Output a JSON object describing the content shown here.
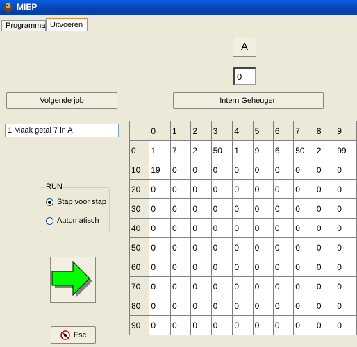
{
  "window": {
    "title": "MIEP"
  },
  "tabs": [
    {
      "label": "Programma"
    },
    {
      "label": "Uitvoeren"
    }
  ],
  "register_label": "A",
  "accumulator_value": "0",
  "buttons": {
    "next_job": "Volgende job",
    "internal_memory": "Intern Geheugen",
    "esc": "Esc"
  },
  "current_job": "1 Maak getal 7 in A",
  "run": {
    "legend": "RUN",
    "options": [
      {
        "label": "Stap voor stap",
        "selected": true
      },
      {
        "label": "Automatisch",
        "selected": false
      }
    ]
  },
  "memory": {
    "columns": [
      "0",
      "1",
      "2",
      "3",
      "4",
      "5",
      "6",
      "7",
      "8",
      "9"
    ],
    "rows": [
      {
        "label": "0",
        "cells": [
          "1",
          "7",
          "2",
          "50",
          "1",
          "9",
          "6",
          "50",
          "2",
          "99"
        ]
      },
      {
        "label": "10",
        "cells": [
          "19",
          "0",
          "0",
          "0",
          "0",
          "0",
          "0",
          "0",
          "0",
          "0"
        ]
      },
      {
        "label": "20",
        "cells": [
          "0",
          "0",
          "0",
          "0",
          "0",
          "0",
          "0",
          "0",
          "0",
          "0"
        ]
      },
      {
        "label": "30",
        "cells": [
          "0",
          "0",
          "0",
          "0",
          "0",
          "0",
          "0",
          "0",
          "0",
          "0"
        ]
      },
      {
        "label": "40",
        "cells": [
          "0",
          "0",
          "0",
          "0",
          "0",
          "0",
          "0",
          "0",
          "0",
          "0"
        ]
      },
      {
        "label": "50",
        "cells": [
          "0",
          "0",
          "0",
          "0",
          "0",
          "0",
          "0",
          "0",
          "0",
          "0"
        ]
      },
      {
        "label": "60",
        "cells": [
          "0",
          "0",
          "0",
          "0",
          "0",
          "0",
          "0",
          "0",
          "0",
          "0"
        ]
      },
      {
        "label": "70",
        "cells": [
          "0",
          "0",
          "0",
          "0",
          "0",
          "0",
          "0",
          "0",
          "0",
          "0"
        ]
      },
      {
        "label": "80",
        "cells": [
          "0",
          "0",
          "0",
          "0",
          "0",
          "0",
          "0",
          "0",
          "0",
          "0"
        ]
      },
      {
        "label": "90",
        "cells": [
          "0",
          "0",
          "0",
          "0",
          "0",
          "0",
          "0",
          "0",
          "0",
          "0"
        ]
      }
    ]
  },
  "colors": {
    "arrow": "#00FF00",
    "titlebar": "#0842B0"
  },
  "icons": {
    "app": "chick-icon",
    "run": "arrow-right-icon",
    "esc": "stop-icon"
  }
}
